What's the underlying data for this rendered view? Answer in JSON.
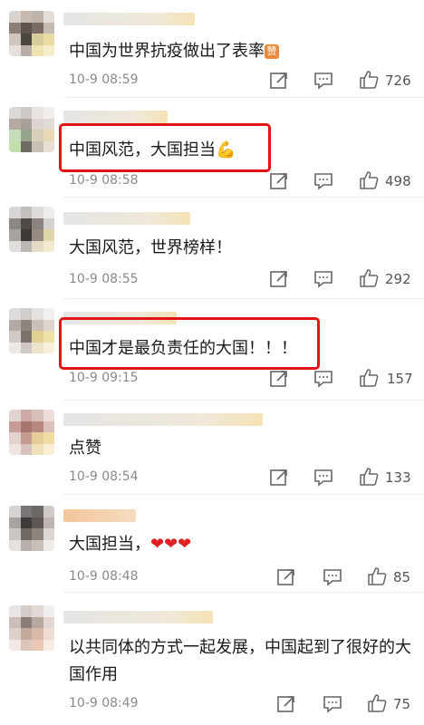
{
  "comments": [
    {
      "text": "中国为世界抗疫做出了表率",
      "badge": "赞",
      "time": "10-9 08:59",
      "likes": "726"
    },
    {
      "text": "中国风范，大国担当",
      "emoji": "💪",
      "time": "10-9 08:58",
      "likes": "498"
    },
    {
      "text": "大国风范，世界榜样！",
      "time": "10-9 08:55",
      "likes": "292"
    },
    {
      "text": "中国才是最负责任的大国！！！",
      "time": "10-9 09:15",
      "likes": "157"
    },
    {
      "text": "点赞",
      "time": "10-9 08:54",
      "likes": "133"
    },
    {
      "text": "大国担当，",
      "hearts": "❤❤❤",
      "time": "10-9 08:48",
      "likes": "85"
    },
    {
      "text": "以共同体的方式一起发展，中国起到了很好的大国作用",
      "time": "10-9 08:49",
      "likes": "75"
    }
  ],
  "icons": {
    "share": "share-icon",
    "comment": "comment-icon",
    "like": "thumbs-up-icon"
  },
  "colors": {
    "highlight": "#e01515",
    "text": "#1a1a1a",
    "meta": "#8a8a8a"
  }
}
